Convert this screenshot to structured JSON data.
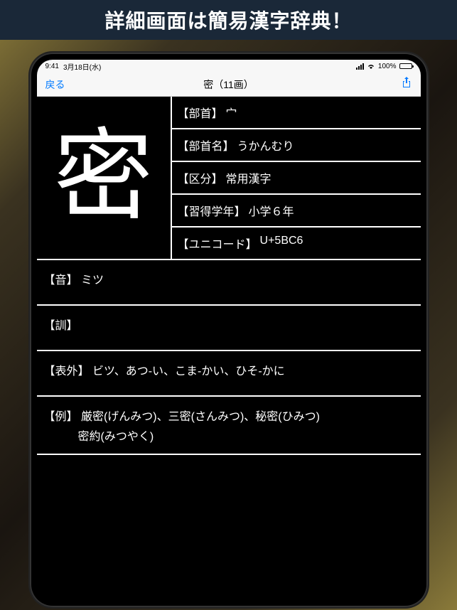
{
  "banner": "詳細画面は簡易漢字辞典！",
  "statusBar": {
    "time": "9:41",
    "date": "3月18日(水)",
    "battery": "100%"
  },
  "nav": {
    "back": "戻る",
    "title": "密（11画）"
  },
  "kanji": "密",
  "info": [
    {
      "label": "【部首】",
      "value": "宀"
    },
    {
      "label": "【部首名】",
      "value": "うかんむり"
    },
    {
      "label": "【区分】",
      "value": "常用漢字"
    },
    {
      "label": "【習得学年】",
      "value": "小学６年"
    },
    {
      "label": "【ユニコード】",
      "value": "U+5BC6"
    }
  ],
  "details": [
    {
      "label": "【音】",
      "value": "ミツ",
      "extra": ""
    },
    {
      "label": "【訓】",
      "value": "",
      "extra": ""
    },
    {
      "label": "【表外】",
      "value": "ビツ、あつ-い、こま-かい、ひそ-かに",
      "extra": ""
    },
    {
      "label": "【例】",
      "value": "厳密(げんみつ)、三密(さんみつ)、秘密(ひみつ)",
      "extra": "密約(みつやく)"
    }
  ]
}
